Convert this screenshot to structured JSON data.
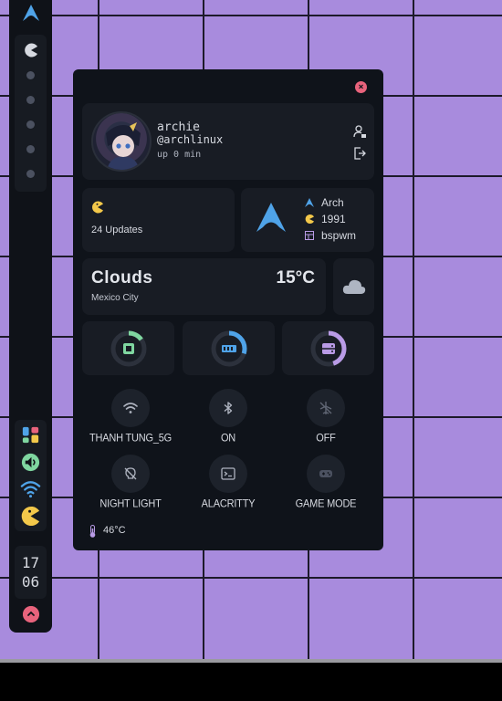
{
  "colors": {
    "wallpaper": "#a88bdd",
    "panel_bg": "#0f131a",
    "card_bg": "#181c24",
    "accent_blue": "#4fa3e8",
    "accent_yellow": "#f3c84a",
    "accent_red": "#e8637c",
    "accent_green": "#7fd6a0",
    "accent_purple": "#b99be6"
  },
  "bar": {
    "logo_icon": "arch-logo-icon",
    "workspace_icon": "pacman-icon",
    "workspace_count": 5,
    "system_icons": [
      "apps-grid-icon",
      "volume-icon",
      "wifi-icon",
      "pacman-icon"
    ],
    "clock": {
      "hour": "17",
      "minute": "06"
    },
    "power_icon": "power-icon"
  },
  "panel": {
    "close_icon": "close-icon",
    "profile": {
      "name": "archie",
      "handle": "@archlinux",
      "uptime": "up 0 min",
      "actions": [
        "user-lock-icon",
        "logout-icon"
      ]
    },
    "updates": {
      "icon": "pacman-icon",
      "text": "24 Updates"
    },
    "distro": {
      "logo_icon": "arch-logo-icon",
      "rows": [
        {
          "icon": "arch-logo-icon",
          "text": "Arch"
        },
        {
          "icon": "pacman-icon",
          "text": "1991"
        },
        {
          "icon": "window-manager-icon",
          "text": "bspwm"
        }
      ]
    },
    "weather": {
      "condition": "Clouds",
      "temperature": "15°C",
      "city": "Mexico City",
      "icon": "cloud-icon"
    },
    "monitors": [
      {
        "name": "cpu",
        "icon": "cpu-icon",
        "color": "#7fd6a0",
        "fraction": 0.15
      },
      {
        "name": "ram",
        "icon": "ram-icon",
        "color": "#4fa3e8",
        "fraction": 0.3
      },
      {
        "name": "disk",
        "icon": "disk-icon",
        "color": "#b99be6",
        "fraction": 0.45
      }
    ],
    "toggles": [
      {
        "name": "wifi",
        "icon": "wifi-icon",
        "label": "THANH TUNG_5G"
      },
      {
        "name": "bluetooth",
        "icon": "bluetooth-icon",
        "label": "ON"
      },
      {
        "name": "airplane",
        "icon": "airplane-icon",
        "label": "OFF"
      },
      {
        "name": "night-light",
        "icon": "night-light-icon",
        "label": "NIGHT LIGHT"
      },
      {
        "name": "terminal",
        "icon": "terminal-icon",
        "label": "ALACRITTY"
      },
      {
        "name": "game-mode",
        "icon": "gamepad-icon",
        "label": "GAME MODE"
      }
    ],
    "cpu_temp": {
      "icon": "thermometer-icon",
      "text": "46°C"
    }
  }
}
